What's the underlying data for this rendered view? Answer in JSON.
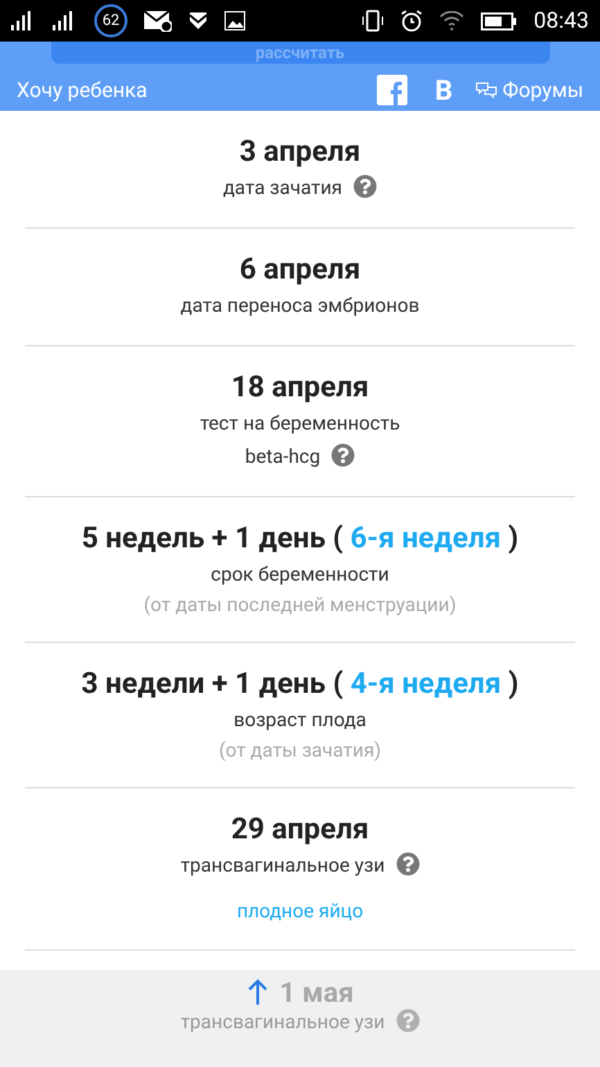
{
  "status_bar": {
    "badge": "62",
    "time": "08:43"
  },
  "header": {
    "calc_button": "рассчитать",
    "title": "Хочу ребенка",
    "vk_label": "В",
    "forums": "Форумы"
  },
  "items": [
    {
      "kind": "normal",
      "date": "3 апреля",
      "label": "дата зачатия",
      "help": true
    },
    {
      "kind": "normal",
      "date": "6 апреля",
      "label": "дата переноса эмбрионов",
      "help": false
    },
    {
      "kind": "normal",
      "date": "18 апреля",
      "label": "тест на беременность",
      "sublabel": "beta-hcg",
      "help": true
    },
    {
      "kind": "normal",
      "date": "5 недель + 1 день (",
      "week": "6-я неделя",
      "date_end": ")",
      "label": "срок беременности",
      "note": "(от даты последней менструации)",
      "help": false
    },
    {
      "kind": "normal",
      "date": "3 недели + 1 день (",
      "week": "4-я неделя",
      "date_end": ")",
      "label": "возраст плода",
      "note": "(от даты зачатия)",
      "help": false
    },
    {
      "kind": "normal",
      "date": "29 апреля",
      "label": "трансвагинальное узи",
      "help": true,
      "link": "плодное яйцо"
    },
    {
      "kind": "faded",
      "date": "1 мая",
      "label": "трансвагинальное узи",
      "help": true
    }
  ]
}
